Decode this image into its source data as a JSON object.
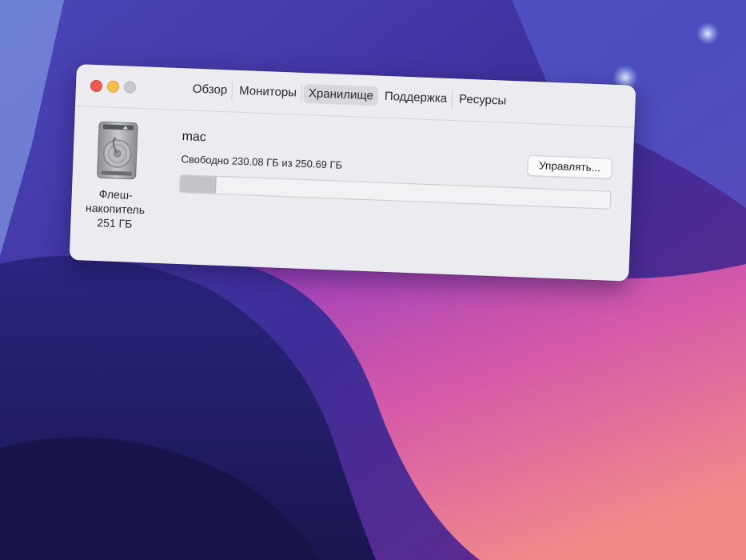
{
  "window": {
    "tabs": [
      {
        "label": "Обзор",
        "active": false
      },
      {
        "label": "Мониторы",
        "active": false
      },
      {
        "label": "Хранилище",
        "active": true
      },
      {
        "label": "Поддержка",
        "active": false
      },
      {
        "label": "Ресурсы",
        "active": false
      }
    ]
  },
  "storage": {
    "disk_icon": "hard-drive-icon",
    "disk_label_line1": "Флеш-",
    "disk_label_line2": "накопитель",
    "disk_label_line3": "251 ГБ",
    "volume_name": "mac",
    "free_text": "Свободно 230.08 ГБ из 250.69 ГБ",
    "manage_label": "Управлять...",
    "used_fraction": 0.0822,
    "used_color": "#c4c3c8"
  },
  "theme": {
    "close_color": "#ee5a52",
    "minimize_color": "#f5be4f",
    "zoom_color": "#c9c8cc"
  }
}
